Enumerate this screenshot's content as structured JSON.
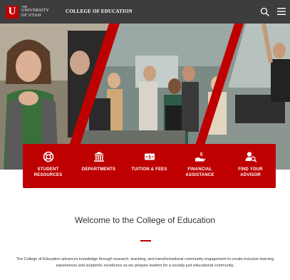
{
  "header": {
    "logo_the": "THE",
    "logo_line1": "UNIVERSITY",
    "logo_line2": "OF UTAH",
    "logo_letter": "U",
    "college_name": "COLLEGE OF EDUCATION",
    "search_icon": "search-icon",
    "menu_icon": "hamburger-menu-icon"
  },
  "quick_links": [
    {
      "label": "STUDENT RESOURCES",
      "icon": "lifebuoy-icon"
    },
    {
      "label": "DEPARTMENTS",
      "icon": "building-columns-icon"
    },
    {
      "label": "TUITION & FEES",
      "icon": "money-bill-icon"
    },
    {
      "label": "FINANCIAL ASSISTANCE",
      "icon": "hand-dollar-icon"
    },
    {
      "label": "FIND YOUR ADVISOR",
      "icon": "user-search-icon"
    }
  ],
  "main": {
    "title": "Welcome to the College of Education",
    "intro": "The College of Education advances knowledge through research, teaching, and transformational community engagement to create inclusive learning experiences and academic excellence as we prepare leaders for a socially just educational community."
  },
  "colors": {
    "brand_red": "#be0000",
    "header_bg": "#3d3d3d",
    "text": "#333333"
  }
}
